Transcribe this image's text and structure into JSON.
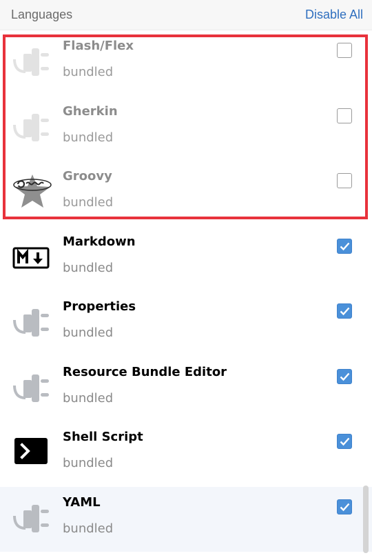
{
  "header": {
    "title": "Languages",
    "action": "Disable All"
  },
  "plugins": [
    {
      "name": "Flash/Flex",
      "subtitle": "bundled",
      "enabled": false,
      "icon": "plugin-plug-icon"
    },
    {
      "name": "Gherkin",
      "subtitle": "bundled",
      "enabled": false,
      "icon": "plugin-plug-icon"
    },
    {
      "name": "Groovy",
      "subtitle": "bundled",
      "enabled": false,
      "icon": "groovy-logo-icon"
    },
    {
      "name": "Markdown",
      "subtitle": "bundled",
      "enabled": true,
      "icon": "markdown-icon"
    },
    {
      "name": "Properties",
      "subtitle": "bundled",
      "enabled": true,
      "icon": "plugin-plug-icon"
    },
    {
      "name": "Resource Bundle Editor",
      "subtitle": "bundled",
      "enabled": true,
      "icon": "plugin-plug-icon"
    },
    {
      "name": "Shell Script",
      "subtitle": "bundled",
      "enabled": true,
      "icon": "terminal-icon"
    },
    {
      "name": "YAML",
      "subtitle": "bundled",
      "enabled": true,
      "icon": "plugin-plug-icon"
    }
  ],
  "colors": {
    "accent": "#4a90d9",
    "link": "#2f6fbf",
    "highlight_border": "#e8323c"
  }
}
